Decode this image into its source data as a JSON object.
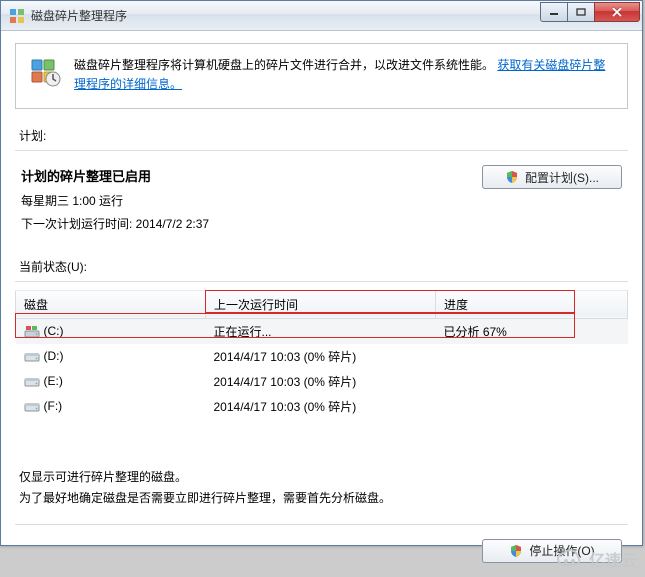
{
  "window": {
    "title": "磁盘碎片整理程序",
    "min_tooltip": "最小化",
    "max_tooltip": "最大化",
    "close_tooltip": "关闭"
  },
  "info": {
    "text_prefix": "磁盘碎片整理程序将计算机硬盘上的碎片文件进行合并，以改进文件系统性能。",
    "link_text": "获取有关磁盘碎片整理程序的详细信息。"
  },
  "schedule": {
    "section_label": "计划:",
    "title": "计划的碎片整理已启用",
    "frequency": "每星期三  1:00 运行",
    "next_run": "下一次计划运行时间: 2014/7/2 2:37",
    "configure_button": "配置计划(S)..."
  },
  "status": {
    "section_label": "当前状态(U):",
    "columns": {
      "disk": "磁盘",
      "last_run": "上一次运行时间",
      "progress": "进度"
    },
    "rows": [
      {
        "icon": "win-drive-icon",
        "name": "(C:)",
        "last_run": "正在运行...",
        "progress": "已分析 67%",
        "selected": true
      },
      {
        "icon": "drive-icon",
        "name": "(D:)",
        "last_run": "2014/4/17 10:03 (0% 碎片)",
        "progress": "",
        "selected": false
      },
      {
        "icon": "drive-icon",
        "name": "(E:)",
        "last_run": "2014/4/17 10:03 (0% 碎片)",
        "progress": "",
        "selected": false
      },
      {
        "icon": "drive-icon",
        "name": "(F:)",
        "last_run": "2014/4/17 10:03 (0% 碎片)",
        "progress": "",
        "selected": false
      }
    ]
  },
  "notes": {
    "line1": "仅显示可进行碎片整理的磁盘。",
    "line2": "为了最好地确定磁盘是否需要立即进行碎片整理，需要首先分析磁盘。"
  },
  "footer": {
    "stop_button": "停止操作(O)"
  },
  "watermark": "亿速云"
}
